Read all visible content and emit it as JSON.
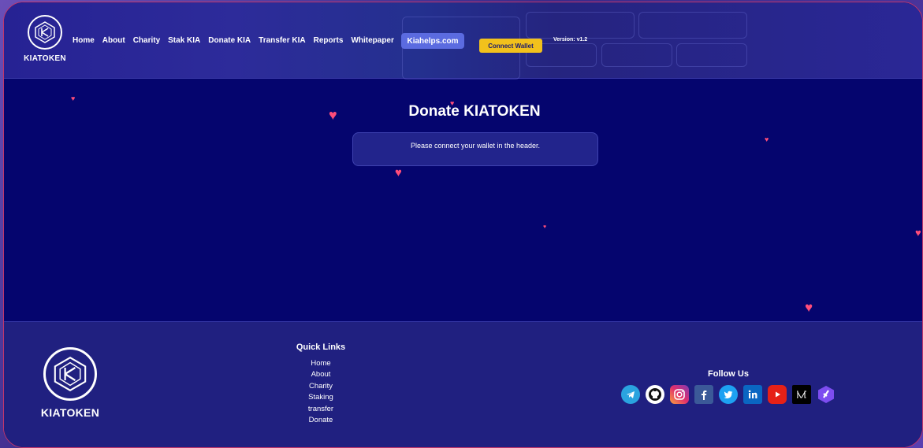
{
  "header": {
    "logo_text": "KIATOKEN",
    "nav": [
      "Home",
      "About",
      "Charity",
      "Stak KIA",
      "Donate KIA",
      "Transfer KIA",
      "Reports",
      "Whitepaper"
    ],
    "kiahelps_label": "Kiahelps.com",
    "connect_label": "Connect Wallet",
    "version": "Version: v1.2"
  },
  "main": {
    "title": "Donate KIATOKEN",
    "notice": "Please connect your wallet in the header."
  },
  "footer": {
    "logo_text": "KIATOKEN",
    "quick_links_title": "Quick Links",
    "quick_links": [
      "Home",
      "About",
      "Charity",
      "Staking",
      "transfer",
      "Donate"
    ],
    "follow_title": "Follow Us",
    "socials": [
      "telegram-icon",
      "github-icon",
      "instagram-icon",
      "facebook-icon",
      "twitter-icon",
      "linkedin-icon",
      "youtube-icon",
      "medium-icon",
      "kia-app-icon"
    ]
  },
  "colors": {
    "background": "#05056e",
    "header": "#2a2796",
    "footer": "#202080",
    "accent_yellow": "#f2c11c",
    "accent_blue": "#5b6be0",
    "heart": "#ff4d7a"
  }
}
